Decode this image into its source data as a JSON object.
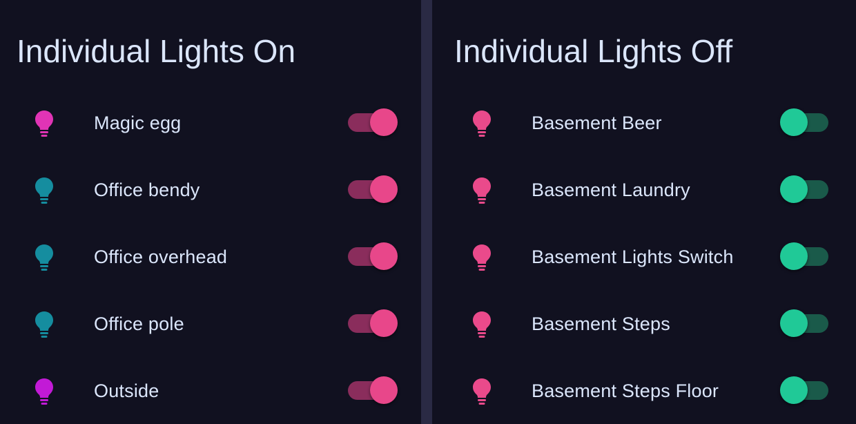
{
  "left_card": {
    "title": "Individual Lights On",
    "rows": [
      {
        "label": "Magic egg",
        "icon": "lightbulb-icon",
        "icon_color": "#e134b5",
        "state": "on"
      },
      {
        "label": "Office bendy",
        "icon": "lightbulb-icon",
        "icon_color": "#158d9f",
        "state": "on"
      },
      {
        "label": "Office overhead",
        "icon": "lightbulb-icon",
        "icon_color": "#158d9f",
        "state": "on"
      },
      {
        "label": "Office pole",
        "icon": "lightbulb-icon",
        "icon_color": "#158d9f",
        "state": "on"
      },
      {
        "label": "Outside",
        "icon": "lightbulb-icon",
        "icon_color": "#c21ad6",
        "state": "on"
      }
    ]
  },
  "right_card": {
    "title": "Individual Lights Off",
    "rows": [
      {
        "label": "Basement Beer",
        "icon": "lightbulb-icon",
        "icon_color": "#ea4a8b",
        "state": "off"
      },
      {
        "label": "Basement Laundry",
        "icon": "lightbulb-icon",
        "icon_color": "#ea4a8b",
        "state": "off"
      },
      {
        "label": "Basement Lights Switch",
        "icon": "lightbulb-icon",
        "icon_color": "#ea4a8b",
        "state": "off"
      },
      {
        "label": "Basement Steps",
        "icon": "lightbulb-icon",
        "icon_color": "#ea4a8b",
        "state": "off"
      },
      {
        "label": "Basement Steps Floor",
        "icon": "lightbulb-icon",
        "icon_color": "#ea4a8b",
        "state": "off"
      }
    ]
  },
  "colors": {
    "background": "#111120",
    "divider": "#2a2a44",
    "text": "#dbe6fb",
    "toggle_on_knob": "#e8478a",
    "toggle_on_track": "#8a2d5c",
    "toggle_off_knob": "#20c997",
    "toggle_off_track": "#1a5a4a"
  }
}
